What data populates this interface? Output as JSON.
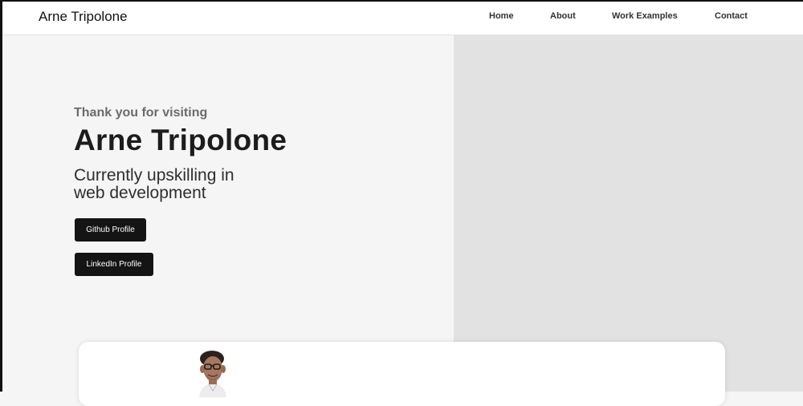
{
  "header": {
    "brand": "Arne Tripolone",
    "nav": [
      {
        "label": "Home"
      },
      {
        "label": "About"
      },
      {
        "label": "Work Examples"
      },
      {
        "label": "Contact"
      }
    ]
  },
  "hero": {
    "greeting": "Thank you for visiting",
    "name": "Arne Tripolone",
    "tagline": "Currently upskilling in web development",
    "buttons": {
      "github": "Github Profile",
      "linkedin": "LinkedIn Profile"
    }
  },
  "colors": {
    "hero_left_bg": "#f4f5f4",
    "hero_right_bg": "#e2e2e2",
    "button_bg": "#141414",
    "button_text": "#ffffff",
    "greeting_text": "#6b6b6b"
  }
}
